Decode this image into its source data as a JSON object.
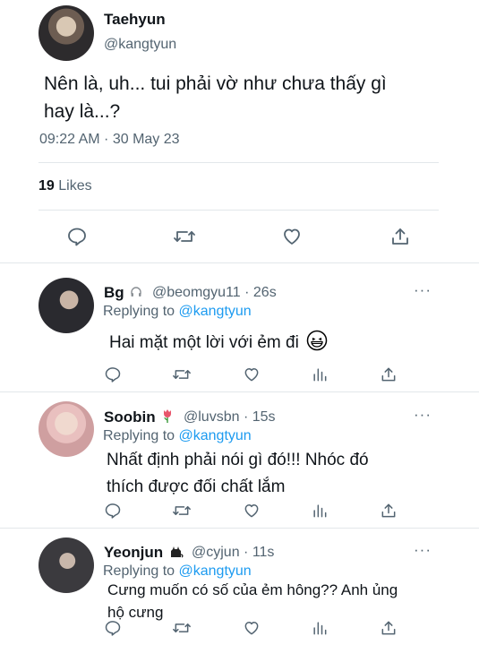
{
  "main_tweet": {
    "name": "Taehyun",
    "handle": "@kangtyun",
    "text_line1": "Nên là, uh... tui phải vờ như chưa thấy gì",
    "text_line2": "hay là...?",
    "timestamp": "09:22 AM · 30 May 23",
    "likes_count": "19",
    "likes_label": "Likes"
  },
  "replying_to_label": "Replying to",
  "replies": [
    {
      "name": "Bg",
      "name_badge_icon": "headphones-icon",
      "handle": "@beomgyu11",
      "time": "· 26s",
      "mention": "@kangtyun",
      "text_line1": "Hai mặt một lời với ẻm đi",
      "text_emoji_icon": "grinning-face-icon"
    },
    {
      "name": "Soobin",
      "name_badge_icon": "tulip-icon",
      "handle": "@luvsbn",
      "time": "· 15s",
      "mention": "@kangtyun",
      "text_line1": "Nhất định phải nói gì đó!!! Nhóc đó",
      "text_line2": "thích được đối chất lắm"
    },
    {
      "name": "Yeonjun",
      "name_badge_icon": "cat-icon",
      "handle": "@cyjun",
      "time": "· 11s",
      "mention": "@kangtyun",
      "text_line1": "Cưng muốn có số của ẻm hông?? Anh ủng",
      "text_line2": "hộ cưng"
    }
  ],
  "more_label": "···",
  "colors": {
    "text": "#0f1419",
    "secondary": "#536471",
    "accent": "#1d9bf0",
    "divider": "#e3e7ea"
  }
}
